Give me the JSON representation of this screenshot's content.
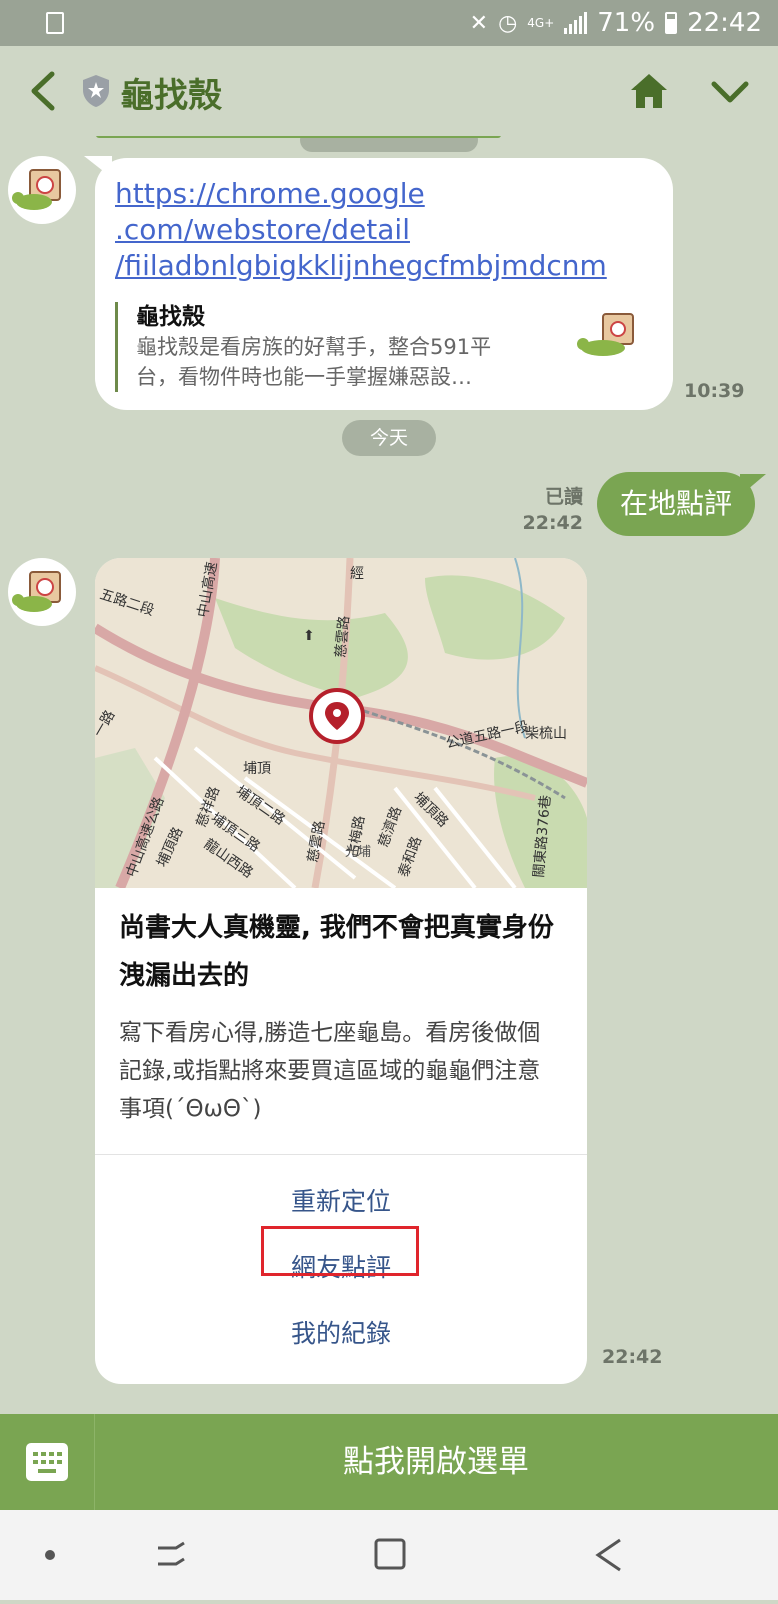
{
  "status_bar": {
    "network": "4G+",
    "battery_percent": "71%",
    "time": "22:42"
  },
  "header": {
    "title": "龜找殼",
    "icons": [
      "back-arrow-icon",
      "shield-badge-icon",
      "home-icon",
      "chevron-down-icon"
    ]
  },
  "messages": {
    "link_message": {
      "url_lines": [
        "https://chrome.google",
        ".com/webstore/detail",
        "/fiiladbnlgbigkklijnhegcfmbjmdcnm"
      ],
      "preview_title": "龜找殼",
      "preview_desc": "龜找殼是看房族的好幫手，整合591平台，看物件時也能一手掌握嫌惡設…",
      "time": "10:39"
    },
    "date_chip": "今天",
    "sent": {
      "read": "已讀",
      "time": "22:42",
      "text": "在地點評"
    },
    "card": {
      "map_labels": {
        "l1": "五路二段",
        "l2": "中山高速",
        "l3": "慈雲路",
        "l4": "經",
        "l5": "柴梳山",
        "l6": "公道五路一段",
        "l7": "埔頂",
        "l8": "中山高速公路",
        "l9": "埔頂路",
        "l10": "慈祥路",
        "l11": "埔頂二路",
        "l12": "埔頂三路",
        "l13": "龍山西路",
        "l14": "慈雲路",
        "l15": "占梅路",
        "l16": "慈濟路",
        "l17": "埔頂路",
        "l18": "光埔",
        "l19": "泰和路",
        "l20": "關東路376巷",
        "l21": "一路"
      },
      "title": "尚書大人真機靈, 我們不會把真實身份洩漏出去的",
      "description": "寫下看房心得,勝造七座龜島。看房後做個記錄,或指點將來要買這區域的龜龜們注意事項(´ΘωΘ`)",
      "actions": [
        "重新定位",
        "網友點評",
        "我的紀錄"
      ],
      "time": "22:42"
    }
  },
  "menu_bar": {
    "label": "點我開啟選單"
  },
  "colors": {
    "accent_green": "#7aa552",
    "chat_bg": "#cfd7c6",
    "link_blue": "#4466cc",
    "action_blue": "#36558a",
    "highlight_red": "#e0252c"
  }
}
